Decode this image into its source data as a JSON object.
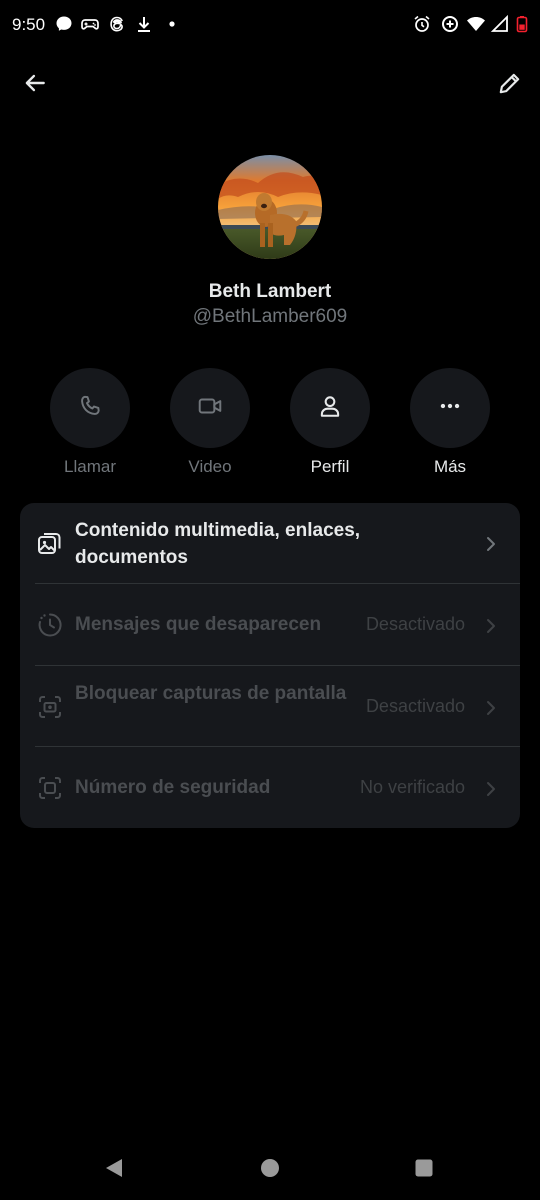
{
  "status_bar": {
    "time": "9:50",
    "left_icons": [
      "messenger-icon",
      "gamepad-icon",
      "threads-icon",
      "download-icon",
      "dot-icon"
    ],
    "right_icons": [
      "alarm-icon",
      "data-saver-icon",
      "wifi-icon",
      "signal-icon",
      "battery-icon"
    ]
  },
  "header": {
    "back_icon": "arrow-left-icon",
    "edit_icon": "pencil-icon"
  },
  "profile": {
    "name": "Beth Lambert",
    "handle": "@BethLamber609"
  },
  "actions": [
    {
      "label": "Llamar",
      "icon": "phone-icon",
      "enabled": false
    },
    {
      "label": "Video",
      "icon": "video-icon",
      "enabled": false
    },
    {
      "label": "Perfil",
      "icon": "person-icon",
      "enabled": true
    },
    {
      "label": "Más",
      "icon": "more-icon",
      "enabled": true
    }
  ],
  "settings": [
    {
      "title": "Contenido multimedia, enlaces, documentos",
      "value": "",
      "icon": "media-icon"
    },
    {
      "title": "Mensajes que desaparecen",
      "value": "Desactivado",
      "icon": "timer-icon"
    },
    {
      "title": "Bloquear capturas de pantalla",
      "value": "Desactivado",
      "icon": "screenshot-icon"
    },
    {
      "title": "Número de seguridad",
      "value": "No verificado",
      "icon": "security-icon"
    }
  ],
  "colors": {
    "background": "#000000",
    "card": "#16181c",
    "text_primary": "#e7e9ea",
    "text_secondary": "#71767b",
    "text_disabled": "#4a4d51",
    "battery": "#f4212e"
  }
}
